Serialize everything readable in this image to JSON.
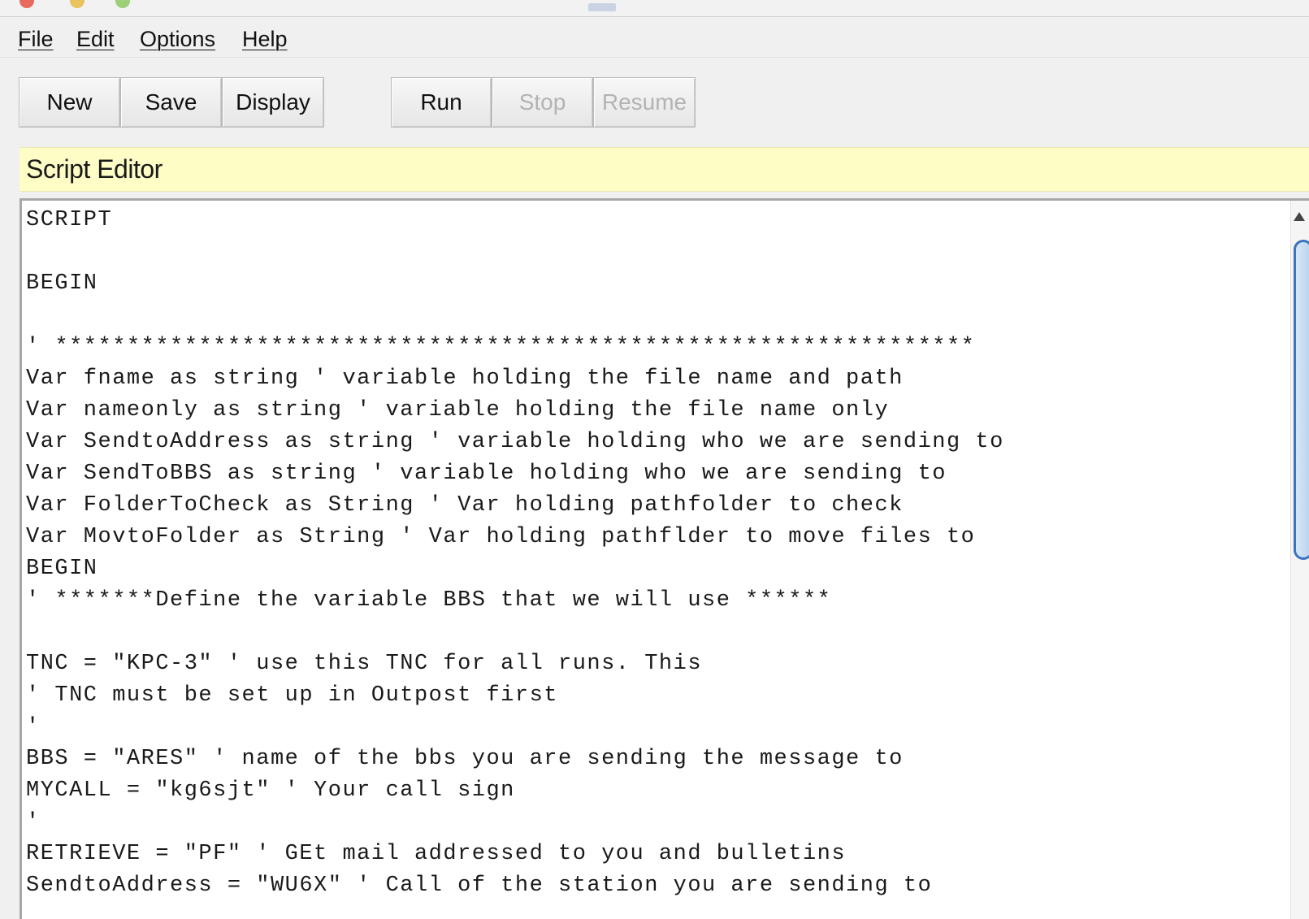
{
  "menu": {
    "items": [
      "File",
      "Edit",
      "Options",
      "Help"
    ]
  },
  "toolbar": {
    "new_label": "New",
    "save_label": "Save",
    "display_label": "Display",
    "run_label": "Run",
    "stop_label": "Stop",
    "resume_label": "Resume"
  },
  "section": {
    "title": "Script Editor"
  },
  "editor": {
    "lines": [
      "SCRIPT",
      "",
      "BEGIN",
      "",
      "' ****************************************************************",
      "Var fname as string ' variable holding the file name and path",
      "Var nameonly as string ' variable holding the file name only",
      "Var SendtoAddress as string ' variable holding who we are sending to",
      "Var SendToBBS as string ' variable holding who we are sending to",
      "Var FolderToCheck as String ' Var holding pathfolder to check",
      "Var MovtoFolder as String ' Var holding pathflder to move files to",
      "BEGIN",
      "' *******Define the variable BBS that we will use ******",
      "",
      "TNC = \"KPC-3\" ' use this TNC for all runs. This",
      "' TNC must be set up in Outpost first",
      "'",
      "BBS = \"ARES\" ' name of the bbs you are sending the message to",
      "MYCALL = \"kg6sjt\" ' Your call sign",
      "'",
      "RETRIEVE = \"PF\" ' GEt mail addressed to you and bulletins",
      "SendtoAddress = \"WU6X\" ' Call of the station you are sending to"
    ]
  },
  "colors": {
    "section_bg": "#fffdc6",
    "scroll_thumb": "#3b73c0",
    "disabled_text": "#b3b3b3"
  }
}
